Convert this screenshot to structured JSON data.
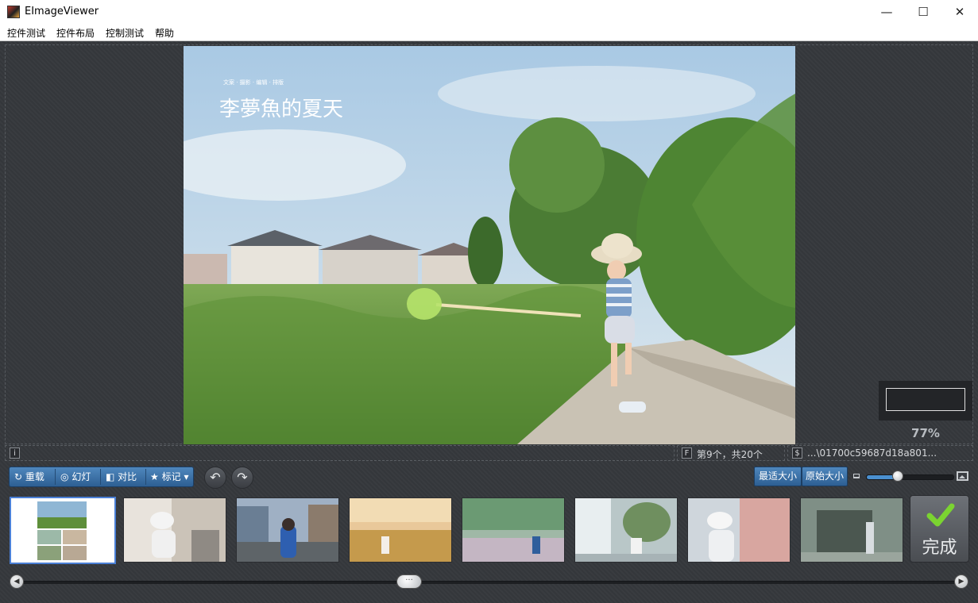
{
  "window": {
    "title": "EImageViewer",
    "minimize": "—",
    "maximize": "☐",
    "close": "✕"
  },
  "menu": [
    "控件测试",
    "控件布局",
    "控制测试",
    "帮助"
  ],
  "photo_caption": {
    "small_text": "文案 · 摄影 · 编辑 · 排版",
    "title": "李夢魚的夏天"
  },
  "zoom": "77%",
  "status": {
    "info_letter": "i",
    "position_letter": "F",
    "position_text": "第9个，共20个",
    "path_letter": "$",
    "path_text": "...\\01700c59687d18a801..."
  },
  "toolbar": {
    "reload": "重载",
    "slideshow": "幻灯",
    "compare": "对比",
    "mark": "标记",
    "fit_size": "最适大小",
    "original_size": "原始大小"
  },
  "zoom_level": 0.35,
  "done_label": "完成",
  "icons": {
    "reload": "↻",
    "slideshow": "◎",
    "compare": "◧",
    "mark": "★",
    "dropdown": "▾",
    "rotate_left": "↶",
    "rotate_right": "↷",
    "check": "✔",
    "scroll_left": "◀",
    "scroll_right": "▶",
    "scroll_grip": "···"
  },
  "colors": {
    "accent_blue": "#4a7fd6",
    "button_blue": "#3a72aa",
    "check_green": "#7bd431"
  }
}
